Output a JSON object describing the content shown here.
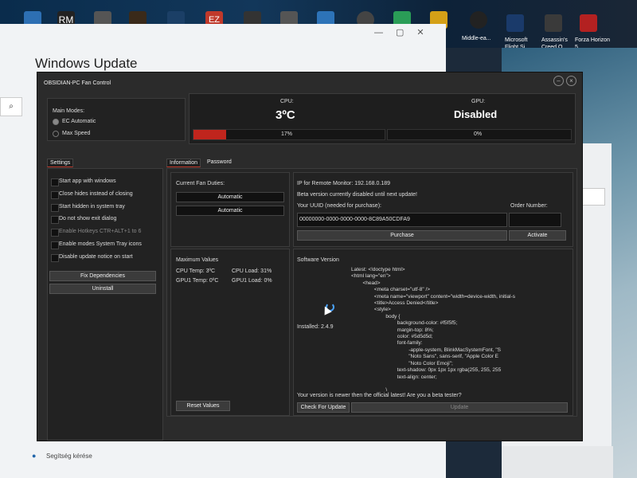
{
  "desktop": {
    "icons": [
      {
        "label": "RM",
        "color": "#222222"
      },
      {
        "label": "EZ",
        "color": "#c0392b"
      },
      {
        "label": "",
        "color": "#2d73b8"
      },
      {
        "label": "",
        "color": "#444444"
      }
    ],
    "shortcuts": [
      {
        "label": "Middle-ea..."
      },
      {
        "label": "Microsoft Flight Si..."
      },
      {
        "label": "Assassin's Creed O..."
      },
      {
        "label": "Forza Horizon 5"
      }
    ]
  },
  "windows_update": {
    "title": "Windows Update",
    "search_icon": "⌕",
    "help_link": "Segítség kérése"
  },
  "app": {
    "title": "OBSIDIAN-PC Fan Control",
    "main_modes_label": "Main Modes:",
    "modes": [
      "EC Automatic",
      "Max Speed"
    ],
    "cpu": {
      "label": "CPU:",
      "temp": "3ºC",
      "percent": "17%",
      "fill": 17
    },
    "gpu": {
      "label": "GPU:",
      "state": "Disabled",
      "percent": "0%",
      "fill": 0
    },
    "left_tab": "Settings",
    "settings": [
      "Start app with windows",
      "Close hides instead of closing",
      "Start hidden in system tray",
      "Do not show exit dialog",
      "Enable Hotkeys CTR+ALT+1 to 6",
      "Enable modes System Tray icons",
      "Disable update notice on start"
    ],
    "fix_button": "Fix Dependencies",
    "uninstall_button": "Uninstall",
    "tabs": [
      "Information",
      "Password"
    ],
    "fan_duties_label": "Current Fan Duties:",
    "fan_duties": [
      "Automatic",
      "Automatic"
    ],
    "max_values_label": "Maximum Values",
    "cpu_temp": "CPU Temp: 3ºC",
    "cpu_load": "CPU Load: 31%",
    "gpu_temp": "GPU1 Temp: 0ºC",
    "gpu_load": "GPU1 Load: 0%",
    "reset_button": "Reset Values",
    "ip_label": "IP for Remote Monitor: 192.168.0.189",
    "beta_note": "Beta version currently disabled until next update!",
    "uuid_label": "Your UUID (needed for purchase):",
    "order_label": "Order Number:",
    "uuid_value": "00000000-0000-0000-0000-8C89A50CDFA9",
    "purchase_button": "Purchase",
    "activate_button": "Activate",
    "software_version_label": "Software Version",
    "latest_code": "Latest: <!doctype html>\n<html lang=\"en\">\n        <head>\n                <meta charset=\"utf-8\" />\n                <meta name=\"viewport\" content=\"width=device-width, initial-s\n                <title>Access Denied</title>\n                <style>\n                        body {\n                                background-color: #f5f5f5;\n                                margin-top: 8%;\n                                color: #5d5d5d;\n                                font-family:\n                                        -apple-system, BlinkMacSystemFont, \"S\n                                        \"Noto Sans\", sans-serif, \"Apple Color E\n                                        \"Noto Color Emoji\";\n                                text-shadow: 0px 1px 1px rgba(255, 255, 255\n                                text-align: center;\n\n                        \\",
    "installed": "Installed: 2.4.9",
    "newer_note": "Your version is newer then the official latest! Are you a beta tester?",
    "check_button": "Check For Update",
    "update_button": "Update",
    "accent": "#c0251d"
  }
}
